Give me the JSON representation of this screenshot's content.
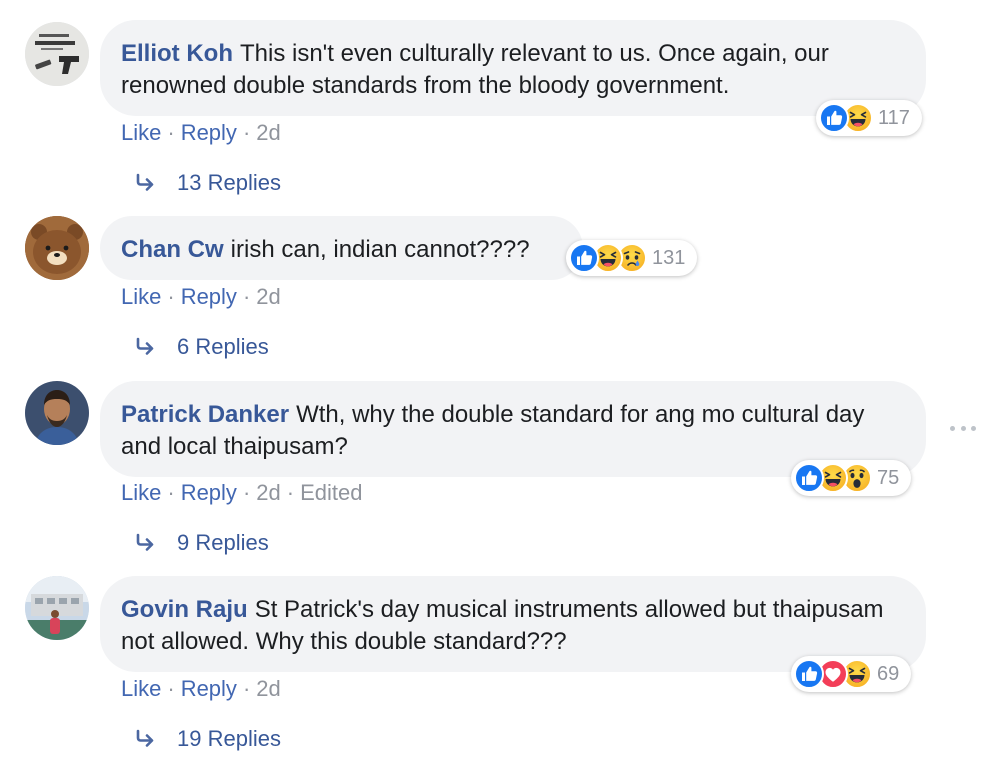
{
  "comments": [
    {
      "author": "Elliot Koh",
      "text": "This isn't even culturally relevant to us. Once again, our renowned double standards from the bloody government.",
      "like_label": "Like",
      "reply_label": "Reply",
      "time": "2d",
      "reaction_count": "117",
      "reaction_icons": [
        "like-icon",
        "haha-icon"
      ],
      "replies_label": "13 Replies"
    },
    {
      "author": "Chan Cw",
      "text": "irish can, indian cannot????",
      "like_label": "Like",
      "reply_label": "Reply",
      "time": "2d",
      "reaction_count": "131",
      "reaction_icons": [
        "like-icon",
        "haha-icon",
        "sad-icon"
      ],
      "replies_label": "6 Replies"
    },
    {
      "author": "Patrick Danker",
      "text": "Wth, why the double standard for ang mo cultural day and local thaipusam?",
      "like_label": "Like",
      "reply_label": "Reply",
      "time": "2d",
      "edited": "Edited",
      "reaction_count": "75",
      "reaction_icons": [
        "like-icon",
        "haha-icon",
        "wow-icon"
      ],
      "replies_label": "9 Replies"
    },
    {
      "author": "Govin Raju",
      "text": "St Patrick's day musical instruments allowed but thaipusam not allowed. Why this double standard???",
      "like_label": "Like",
      "reply_label": "Reply",
      "time": "2d",
      "reaction_count": "69",
      "reaction_icons": [
        "like-icon",
        "love-icon",
        "haha-icon"
      ],
      "replies_label": "19 Replies"
    }
  ],
  "colors": {
    "author": "#385898",
    "action_link": "#4267b2",
    "meta_gray": "#90949c",
    "bubble_bg": "#f2f3f5",
    "like_blue": "#1877f2",
    "love_red": "#f33e58",
    "emoji_yellow": "#f7b125"
  }
}
